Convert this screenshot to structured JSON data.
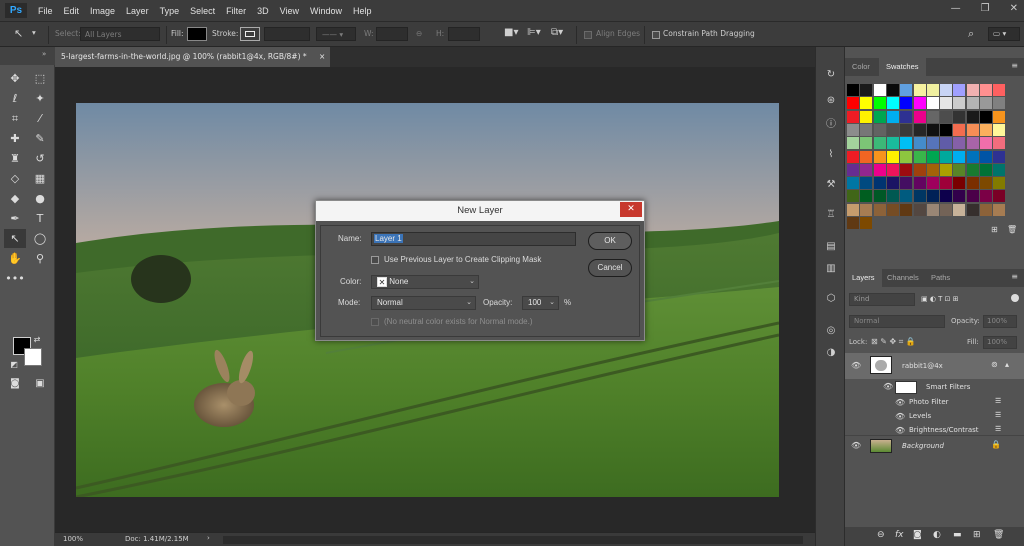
{
  "app": {
    "logo": "Ps"
  },
  "menu": [
    "File",
    "Edit",
    "Image",
    "Layer",
    "Type",
    "Select",
    "Filter",
    "3D",
    "View",
    "Window",
    "Help"
  ],
  "window_controls": {
    "minimize": "—",
    "restore": "❐",
    "close": "✕"
  },
  "options_bar": {
    "select_label": "Select:",
    "select_value": "All Layers",
    "fill_label": "Fill:",
    "stroke_label": "Stroke:",
    "w_label": "W:",
    "h_label": "H:",
    "align_edges": "Align Edges",
    "constrain": "Constrain Path Dragging"
  },
  "document": {
    "tab_title": "5-largest-farms-in-the-world.jpg @ 100% (rabbit1@4x, RGB/8#) *",
    "tab_close": "×",
    "zoom": "100%",
    "doc_info": "Doc: 1.41M/2.15M"
  },
  "panels": {
    "color_tabs": [
      "Color",
      "Swatches"
    ],
    "layers_tabs": [
      "Layers",
      "Channels",
      "Paths"
    ],
    "kind_placeholder": "Kind",
    "blend_mode": "Normal",
    "opacity_label": "Opacity:",
    "opacity_value": "100%",
    "lock_label": "Lock:",
    "fill_label": "Fill:",
    "fill_value": "100%"
  },
  "swatches": [
    [
      "#000000",
      "#1a1a1a",
      "#ffffff",
      "#0a0a0a",
      "#60a0e0",
      "#f7f2a0",
      "#f0f0a0",
      "#c8d4f4",
      "#a0a0ff",
      "#f0b0b0",
      "#ff9090",
      "#ff6060"
    ],
    [
      "#ff0000",
      "#ffff00",
      "#00ff00",
      "#00ffff",
      "#0000ff",
      "#ff00ff",
      "#ffffff",
      "#e6e6e6",
      "#cccccc",
      "#b3b3b3",
      "#999999",
      "#808080"
    ],
    [
      "#ed1c24",
      "#fff200",
      "#00a651",
      "#00aeef",
      "#2e3192",
      "#ec008c",
      "#666666",
      "#4d4d4d",
      "#333333",
      "#1a1a1a",
      "#000000",
      "#f7941d"
    ],
    [
      "#8c8c8c",
      "#777777",
      "#626262",
      "#4e4e4e",
      "#3a3a3a",
      "#262626",
      "#111111",
      "#000000",
      "#f26c4f",
      "#f68e56",
      "#fbaf5d",
      "#fff799"
    ],
    [
      "#a3d39c",
      "#7cc576",
      "#3cb878",
      "#1abc9c",
      "#00bff3",
      "#448ccb",
      "#5674b9",
      "#605ca8",
      "#8560a8",
      "#a864a8",
      "#f06eaa",
      "#f26d7d"
    ],
    [
      "#ed1c24",
      "#f26522",
      "#f7941d",
      "#fff200",
      "#8dc63f",
      "#39b54a",
      "#00a651",
      "#00a99d",
      "#00aeef",
      "#0072bc",
      "#0054a6",
      "#2e3192"
    ],
    [
      "#662d91",
      "#92278f",
      "#ec008c",
      "#ed145b",
      "#9e0b0f",
      "#a0410d",
      "#a36209",
      "#aba000",
      "#598527",
      "#197b30",
      "#007236",
      "#00746b"
    ],
    [
      "#0076a3",
      "#004a80",
      "#003471",
      "#1b1464",
      "#440e62",
      "#630460",
      "#9e005d",
      "#9e0039",
      "#790000",
      "#7b2e00",
      "#7d4900",
      "#827b00"
    ],
    [
      "#406618",
      "#005e20",
      "#005826",
      "#005952",
      "#005b7f",
      "#003663",
      "#002157",
      "#0d004c",
      "#32004b",
      "#4b0049",
      "#7b0046",
      "#7a0026"
    ],
    [
      "#c69c6d",
      "#a67c52",
      "#8c6239",
      "#754c24",
      "#603913",
      "#534741",
      "#998675",
      "#736357",
      "#c7b299",
      "#362f2d",
      "#8c6239",
      "#a67c52"
    ],
    [
      "#603913",
      "#7d4900"
    ]
  ],
  "layers": {
    "items": [
      {
        "name": "rabbit1@4x"
      },
      {
        "name": "Smart Filters"
      },
      {
        "name": "Photo Filter"
      },
      {
        "name": "Levels"
      },
      {
        "name": "Brightness/Contrast"
      },
      {
        "name": "Background"
      }
    ]
  },
  "dialog": {
    "title": "New Layer",
    "close": "✕",
    "name_label": "Name:",
    "name_value": "Layer 1",
    "clip_label": "Use Previous Layer to Create Clipping Mask",
    "color_label": "Color:",
    "color_value": "None",
    "mode_label": "Mode:",
    "mode_value": "Normal",
    "opacity_label": "Opacity:",
    "opacity_value": "100",
    "opacity_unit": "%",
    "neutral_label": "(No neutral color exists for Normal mode.)",
    "ok": "OK",
    "cancel": "Cancel"
  }
}
